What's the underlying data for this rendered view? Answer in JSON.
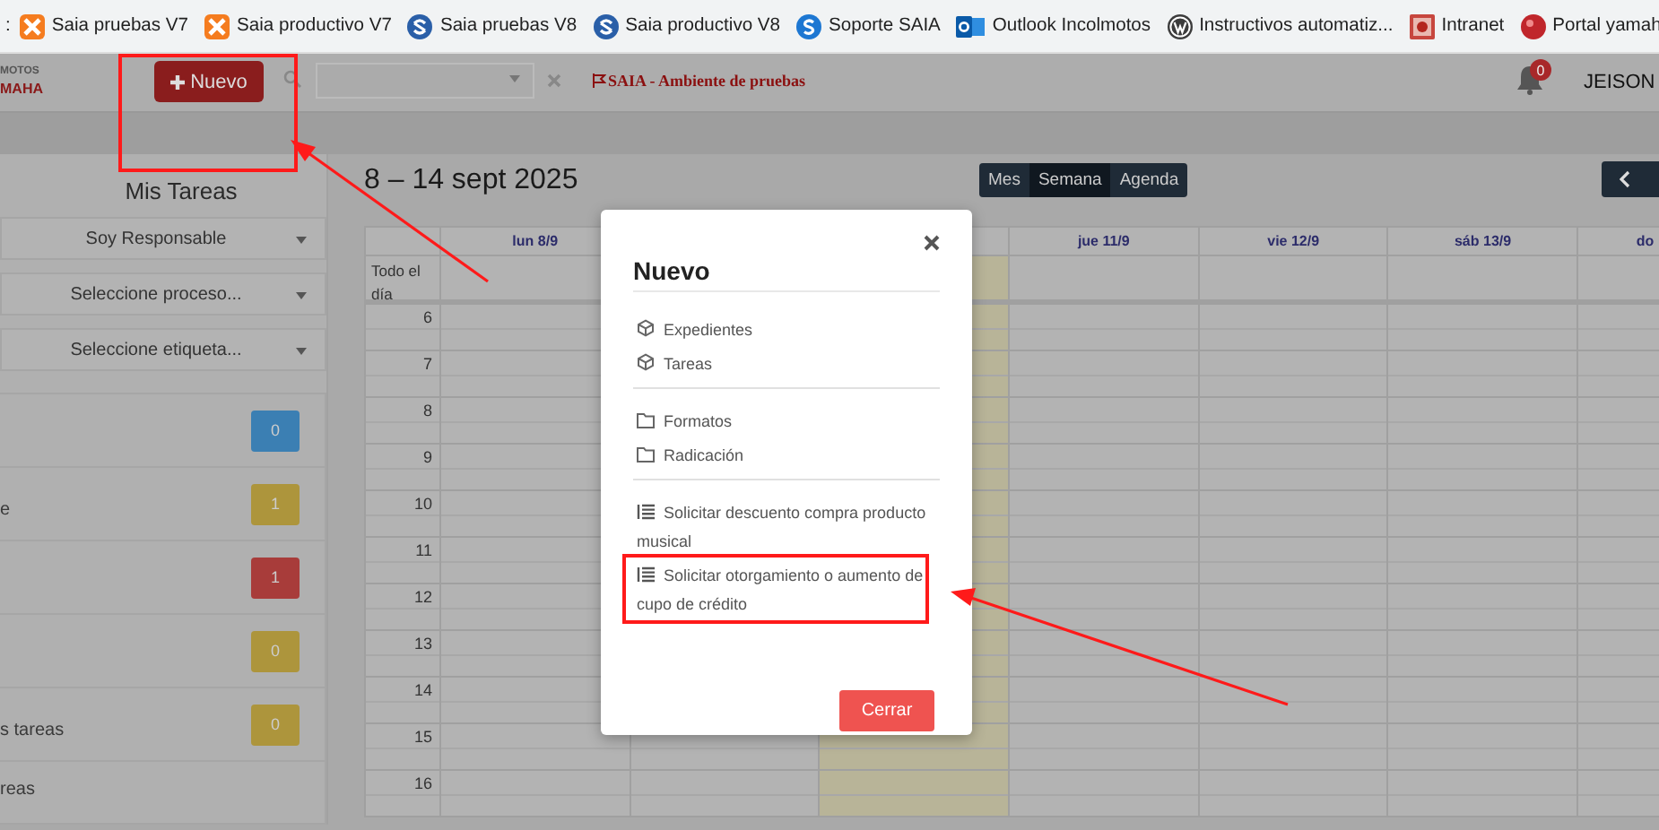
{
  "bookmarks": {
    "partial": ":",
    "items": [
      {
        "label": "Saia pruebas V7",
        "kind": "xampp"
      },
      {
        "label": "Saia productivo V7",
        "kind": "xampp"
      },
      {
        "label": "Saia pruebas V8",
        "kind": "saia"
      },
      {
        "label": "Saia productivo V8",
        "kind": "saia"
      },
      {
        "label": "Soporte SAIA",
        "kind": "support"
      },
      {
        "label": "Outlook Incolmotos",
        "kind": "mail"
      },
      {
        "label": "Instructivos automatiz...",
        "kind": "blog"
      },
      {
        "label": "Intranet",
        "kind": "image"
      },
      {
        "label": "Portal yamah",
        "kind": "portal"
      }
    ]
  },
  "header": {
    "logo_top": "MOTOS",
    "logo_bottom": "MAHA",
    "new_button": "Nuevo",
    "environment": "SAIA - Ambiente de pruebas",
    "notifications": "0",
    "user": "JEISON"
  },
  "tasks": {
    "title": "Mis Tareas",
    "filters": [
      {
        "value": "Soy Responsable"
      },
      {
        "value": "Seleccione proceso..."
      },
      {
        "value": "Seleccione etiqueta..."
      }
    ],
    "counters": [
      {
        "count": "0",
        "color": "#3b7fb3"
      },
      {
        "label": "e",
        "count": "1",
        "color": "#ad953c"
      },
      {
        "count": "1",
        "color": "#a83c3a"
      },
      {
        "count": "0",
        "color": "#ad953c"
      },
      {
        "label": "s tareas",
        "count": "0",
        "color": "#ad953c"
      },
      {
        "label": "reas"
      }
    ]
  },
  "calendar": {
    "title": "8 – 14 sept 2025",
    "views": [
      {
        "label": "Mes",
        "selected": false
      },
      {
        "label": "Semana",
        "selected": true
      },
      {
        "label": "Agenda",
        "selected": false
      }
    ],
    "all_day": "Todo el día",
    "hours": [
      "6",
      "7",
      "8",
      "9",
      "10",
      "11",
      "12",
      "13",
      "14",
      "15",
      "16"
    ],
    "days": [
      {
        "label": "lun 8/9",
        "today": false
      },
      {
        "today": false
      },
      {
        "today": true
      },
      {
        "label": "jue 11/9",
        "today": false
      },
      {
        "label": "vie 12/9",
        "today": false
      },
      {
        "label": "sáb 13/9",
        "today": false
      },
      {
        "label": "do",
        "today": false
      }
    ]
  },
  "modal": {
    "title": "Nuevo",
    "sections": [
      {
        "items": [
          {
            "label": "Expedientes",
            "kind": "module"
          },
          {
            "label": "Tareas",
            "kind": "module"
          }
        ]
      },
      {
        "items": [
          {
            "label": "Formatos",
            "kind": "folder"
          },
          {
            "label": "Radicación",
            "kind": "folder"
          }
        ]
      },
      {
        "items": [
          {
            "label": "Solicitar descuento compra producto musical",
            "kind": "form"
          },
          {
            "label": "Solicitar otorgamiento o aumento de cupo de crédito",
            "kind": "form"
          }
        ]
      }
    ],
    "close_button": "Cerrar"
  }
}
